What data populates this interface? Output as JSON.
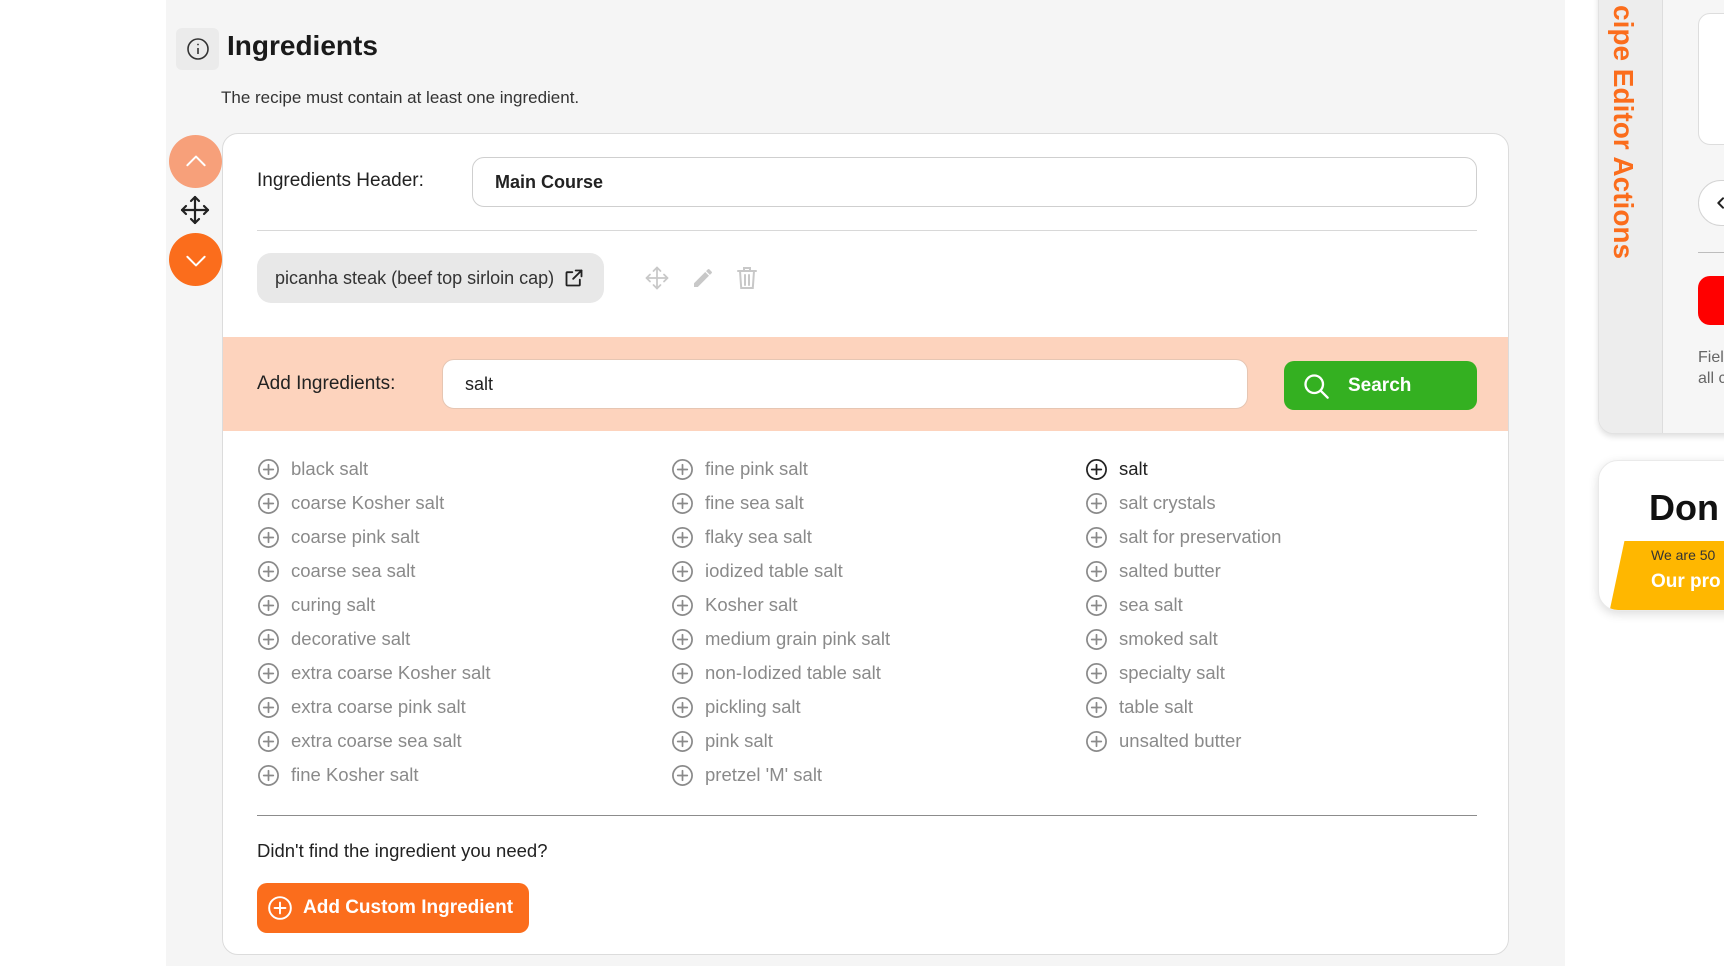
{
  "section": {
    "title": "Ingredients",
    "description": "The recipe must contain at least one ingredient."
  },
  "group": {
    "header_label": "Ingredients Header:",
    "header_value": "Main Course",
    "ingredients": [
      {
        "name": "picanha steak (beef top sirloin cap)"
      }
    ]
  },
  "add": {
    "label": "Add Ingredients:",
    "query": "salt",
    "search_label": "Search"
  },
  "results": {
    "columns": [
      [
        "black salt",
        "coarse Kosher salt",
        "coarse pink salt",
        "coarse sea salt",
        "curing salt",
        "decorative salt",
        "extra coarse Kosher salt",
        "extra coarse pink salt",
        "extra coarse sea salt",
        "fine Kosher salt"
      ],
      [
        "fine pink salt",
        "fine sea salt",
        "flaky sea salt",
        "iodized table salt",
        "Kosher salt",
        "medium grain pink salt",
        "non-Iodized table salt",
        "pickling salt",
        "pink salt",
        "pretzel 'M' salt"
      ],
      [
        "salt",
        "salt crystals",
        "salt for preservation",
        "salted butter",
        "sea salt",
        "smoked salt",
        "specialty salt",
        "table salt",
        "unsalted butter"
      ]
    ],
    "highlighted": "salt"
  },
  "custom": {
    "prompt": "Didn't find the ingredient you need?",
    "button_label": "Add Custom Ingredient"
  },
  "side_panel": {
    "title": "cipe Editor Actions",
    "note": "Fiel\nall c"
  },
  "donate": {
    "title": "Don",
    "subtitle": "We are 50",
    "cta": "Our pro"
  },
  "colors": {
    "accent_orange": "#fb6d1c",
    "light_orange": "#f7a07a",
    "band_peach": "#fdd3bd",
    "search_green": "#34b021",
    "donate_yellow": "#ffb700",
    "panel_red": "#ff0000"
  },
  "icons": {
    "info": "info-icon",
    "up": "chevron-up-icon",
    "move": "move-arrows-icon",
    "down": "chevron-down-icon",
    "external": "external-link-icon",
    "edit": "pencil-icon",
    "delete": "trash-icon",
    "search": "search-icon",
    "add": "plus-circle-icon",
    "back": "chevron-left-icon"
  }
}
